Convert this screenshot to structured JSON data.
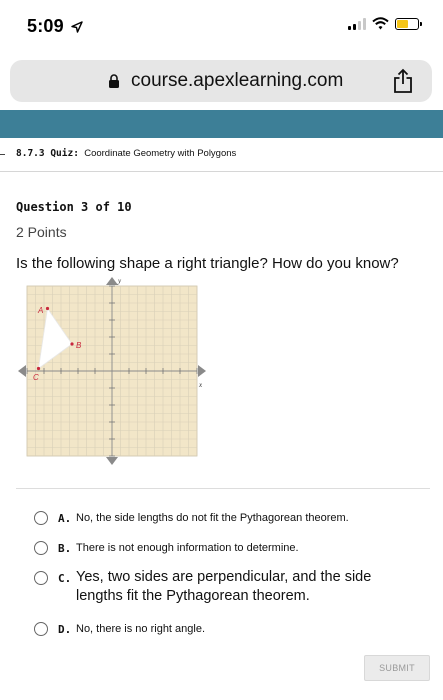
{
  "status_bar": {
    "time": "5:09",
    "location_arrow": "location-arrow-icon"
  },
  "browser": {
    "url": "course.apexlearning.com"
  },
  "quiz": {
    "code": "8.7.3 Quiz:",
    "title": "Coordinate Geometry with Polygons"
  },
  "question": {
    "number_label": "Question 3 of 10",
    "points_label": "2 Points",
    "prompt": "Is the following shape a right triangle? How do you know?"
  },
  "graph": {
    "axis_x_label": "x",
    "axis_y_label": "y",
    "points": {
      "A": "A",
      "B": "B",
      "C": "C"
    }
  },
  "choices": [
    {
      "letter": "A.",
      "text": "No, the side lengths do not fit the Pythagorean theorem."
    },
    {
      "letter": "B.",
      "text": "There is not enough information to determine."
    },
    {
      "letter": "C.",
      "text": "Yes, two sides are perpendicular, and the side lengths fit the Pythagorean theorem."
    },
    {
      "letter": "D.",
      "text": "No, there is no right angle."
    }
  ],
  "submit_label": "SUBMIT",
  "colors": {
    "teal_bar": "#3d7f97",
    "graph_bg": "#f2e6c8",
    "point_red": "#c8283c"
  }
}
